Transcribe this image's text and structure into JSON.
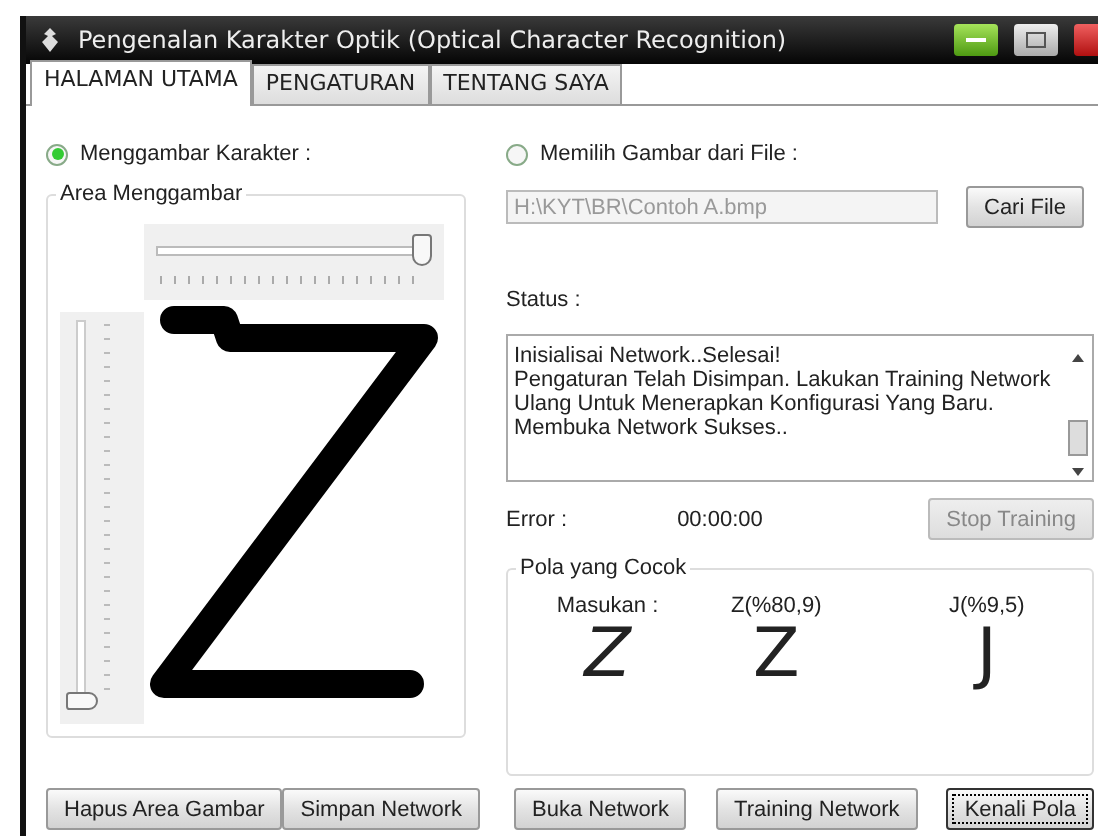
{
  "window": {
    "title": "Pengenalan Karakter Optik (Optical Character Recognition)"
  },
  "tabs": [
    {
      "label": "HALAMAN UTAMA",
      "selected": true
    },
    {
      "label": "PENGATURAN",
      "selected": false
    },
    {
      "label": "TENTANG SAYA",
      "selected": false
    }
  ],
  "draw_mode": {
    "label": "Menggambar Karakter :",
    "selected": true
  },
  "drawing_area": {
    "title": "Area Menggambar",
    "horizontal_slider": {
      "level": 1
    },
    "vertical_slider": {
      "level": 0
    }
  },
  "file_mode": {
    "label": "Memilih Gambar dari File :",
    "selected": false
  },
  "file_path": {
    "value": "H:\\KYT\\BR\\Contoh A.bmp",
    "disabled": true
  },
  "browse_button": {
    "label": "Cari File",
    "disabled": false
  },
  "status": {
    "label": "Status :",
    "text": "Inisialisai Network..Selesai!\nPengaturan Telah Disimpan. Lakukan Training Network Ulang Untuk Menerapkan Konfigurasi Yang Baru.\nMembuka Network Sukses.."
  },
  "error": {
    "label": "Error :",
    "time": "00:00:00"
  },
  "stop_button": {
    "label": "Stop Training",
    "disabled": true
  },
  "matches": {
    "title": "Pola yang Cocok",
    "items": [
      {
        "label": "Masukan :",
        "glyph": "Z",
        "kind": "input"
      },
      {
        "label": "Z(%80,9)",
        "glyph": "Z",
        "kind": "match"
      },
      {
        "label": "J(%9,5)",
        "glyph": "J",
        "kind": "match"
      }
    ]
  },
  "left_buttons": [
    {
      "label": "Hapus Area Gambar",
      "focused": false
    },
    {
      "label": "Simpan Network",
      "focused": false
    }
  ],
  "right_buttons": [
    {
      "label": "Buka Network",
      "focused": false
    },
    {
      "label": "Training Network",
      "focused": false
    },
    {
      "label": "Kenali Pola",
      "focused": true
    }
  ]
}
